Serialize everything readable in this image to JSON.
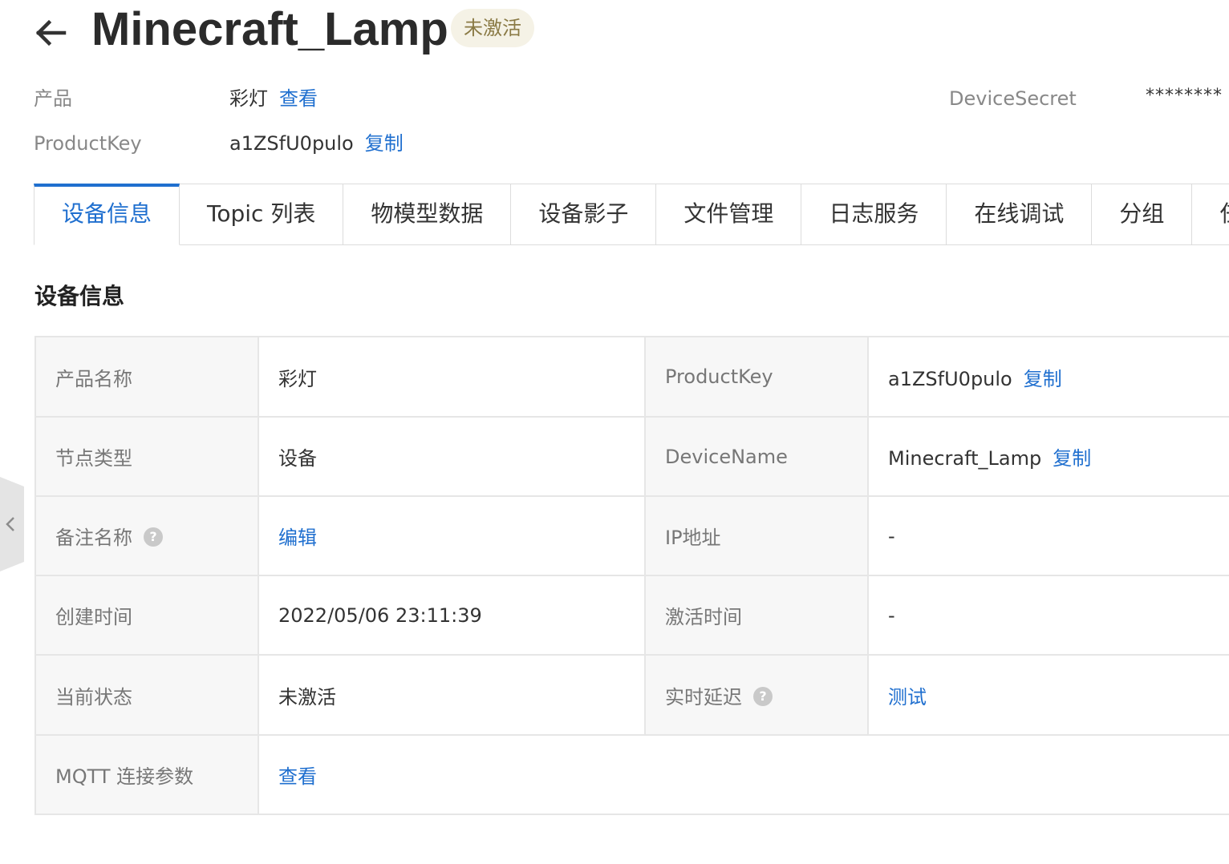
{
  "header": {
    "title": "Minecraft_Lamp",
    "status_badge": "未激活"
  },
  "meta": {
    "product_label": "产品",
    "product_value": "彩灯",
    "product_link": "查看",
    "productkey_label": "ProductKey",
    "productkey_value": "a1ZSfU0pulo",
    "productkey_link": "复制",
    "secret_label": "DeviceSecret",
    "secret_value": "********"
  },
  "tabs": [
    {
      "label": "设备信息",
      "active": true
    },
    {
      "label": "Topic 列表"
    },
    {
      "label": "物模型数据"
    },
    {
      "label": "设备影子"
    },
    {
      "label": "文件管理"
    },
    {
      "label": "日志服务"
    },
    {
      "label": "在线调试"
    },
    {
      "label": "分组"
    },
    {
      "label": "任务"
    }
  ],
  "section": {
    "title": "设备信息"
  },
  "info": {
    "row1": {
      "l1": "产品名称",
      "v1": "彩灯",
      "l2": "ProductKey",
      "v2": "a1ZSfU0pulo",
      "v2_link": "复制"
    },
    "row2": {
      "l1": "节点类型",
      "v1": "设备",
      "l2": "DeviceName",
      "v2": "Minecraft_Lamp",
      "v2_link": "复制"
    },
    "row3": {
      "l1": "备注名称",
      "v1_link": "编辑",
      "l2": "IP地址",
      "v2": "-"
    },
    "row4": {
      "l1": "创建时间",
      "v1": "2022/05/06 23:11:39",
      "l2": "激活时间",
      "v2": "-"
    },
    "row5": {
      "l1": "当前状态",
      "v1": "未激活",
      "l2": "实时延迟",
      "v2_link": "测试"
    },
    "row6": {
      "l1": "MQTT 连接参数",
      "v1_link": "查看"
    }
  },
  "icons": {
    "back": "arrow-left-icon",
    "help": "question-circle-icon",
    "side": "chevron-left-icon"
  },
  "colors": {
    "link": "#1f6fcf",
    "badge_bg": "#f5f2e6",
    "badge_text": "#8a7a45",
    "label_bg": "#f7f7f7",
    "border": "#e6e6e6"
  }
}
